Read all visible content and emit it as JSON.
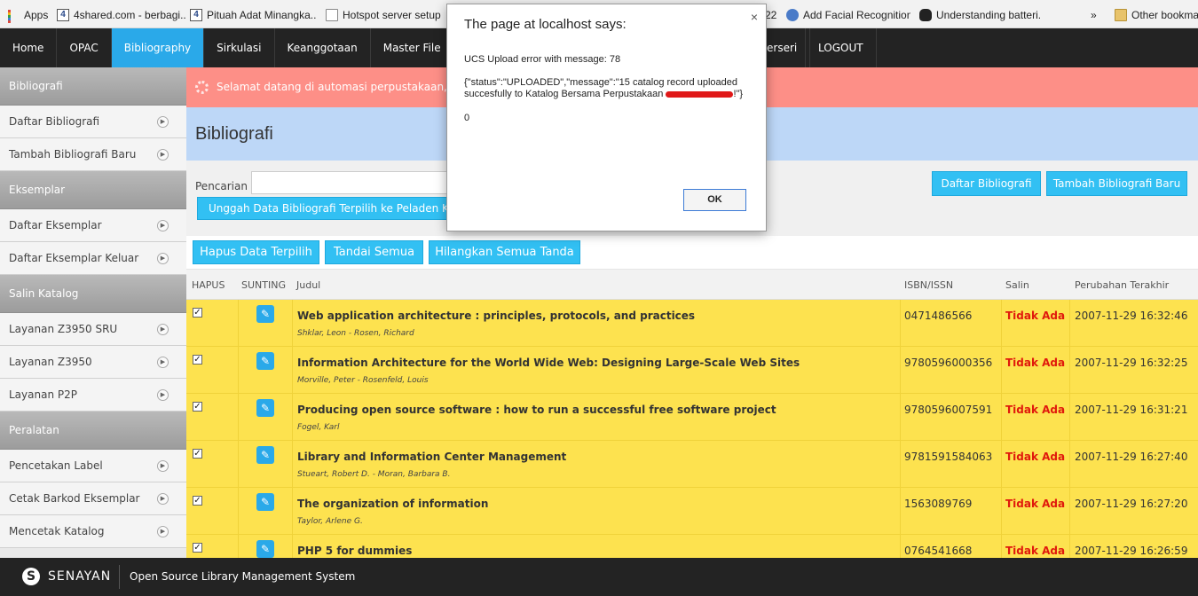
{
  "bookmarks": [
    {
      "label": "Apps",
      "icon": "apps-icon"
    },
    {
      "label": "4shared.com - berbagi...",
      "icon": "4shared-icon"
    },
    {
      "label": "Pituah Adat Minangka...",
      "icon": "4shared-icon"
    },
    {
      "label": "Hotspot server setup ...",
      "icon": "page-icon"
    },
    {
      "label": "22",
      "icon": ""
    },
    {
      "label": "Add Facial Recognition...",
      "icon": "link-icon"
    },
    {
      "label": "Understanding batteri...",
      "icon": "tux-icon"
    },
    {
      "label": "»",
      "icon": ""
    },
    {
      "label": "Other bookmark",
      "icon": "folder-icon"
    }
  ],
  "nav": {
    "items": [
      "Home",
      "OPAC",
      "Bibliography",
      "Sirkulasi",
      "Keanggotaan",
      "Master File"
    ],
    "right_items": [
      "erseri",
      "LOGOUT"
    ],
    "active_color": "#2aa9e9"
  },
  "sidebar": {
    "sections": [
      {
        "heading": "Bibliografi",
        "items": [
          "Daftar Bibliografi",
          "Tambah Bibliografi Baru"
        ]
      },
      {
        "heading": "Eksemplar",
        "items": [
          "Daftar Eksemplar",
          "Daftar Eksemplar Keluar"
        ]
      },
      {
        "heading": "Salin Katalog",
        "items": [
          "Layanan Z3950 SRU",
          "Layanan Z3950",
          "Layanan P2P"
        ]
      },
      {
        "heading": "Peralatan",
        "items": [
          "Pencetakan Label",
          "Cetak Barkod Eksemplar",
          "Mencetak Katalog"
        ]
      }
    ]
  },
  "main": {
    "welcome": "Selamat datang di automasi perpustakaan, saat",
    "title": "Bibliografi",
    "search_label": "Pencarian :",
    "search_value": "",
    "upload_button": "Unggah Data Bibliografi Terpilih ke Peladen Katalog",
    "list_button": "Daftar Bibliografi",
    "add_button": "Tambah Bibliografi Baru",
    "toolbar": {
      "delete_selected": "Hapus Data Terpilih",
      "mark_all": "Tandai Semua",
      "unmark_all": "Hilangkan Semua Tanda"
    },
    "columns": {
      "hapus": "HAPUS",
      "sunting": "SUNTING",
      "judul": "Judul",
      "isbn": "ISBN/ISSN",
      "salin": "Salin",
      "updated": "Perubahan Terakhir"
    },
    "rows": [
      {
        "title": "Web application architecture : principles, protocols, and practices",
        "author": "Shklar, Leon - Rosen, Richard",
        "isbn": "0471486566",
        "salin": "Tidak Ada",
        "updated": "2007-11-29 16:32:46"
      },
      {
        "title": "Information Architecture for the World Wide Web: Designing Large-Scale Web Sites",
        "author": "Morville, Peter - Rosenfeld, Louis",
        "isbn": "9780596000356",
        "salin": "Tidak Ada",
        "updated": "2007-11-29 16:32:25"
      },
      {
        "title": "Producing open source software : how to run a successful free software project",
        "author": "Fogel, Karl",
        "isbn": "9780596007591",
        "salin": "Tidak Ada",
        "updated": "2007-11-29 16:31:21"
      },
      {
        "title": "Library and Information Center Management",
        "author": "Stueart, Robert D. - Moran, Barbara B.",
        "isbn": "9781591584063",
        "salin": "Tidak Ada",
        "updated": "2007-11-29 16:27:40"
      },
      {
        "title": "The organization of information",
        "author": "Taylor, Arlene G.",
        "isbn": "1563089769",
        "salin": "Tidak Ada",
        "updated": "2007-11-29 16:27:20"
      },
      {
        "title": "PHP 5 for dummies",
        "author": "",
        "isbn": "0764541668",
        "salin": "Tidak Ada",
        "updated": "2007-11-29 16:26:59"
      }
    ]
  },
  "footer": {
    "brand": "SENAYAN",
    "tagline": "Open Source Library Management System"
  },
  "dialog": {
    "title": "The page at localhost says:",
    "line1": "UCS Upload error with message: 78",
    "line2_start": "{\"status\":\"UPLOADED\",\"message\":\"15 catalog record uploaded succesfully to Katalog Bersama Perpustakaan ",
    "line2_end": "!\"}",
    "line3": "0",
    "ok": "OK",
    "close": "×"
  }
}
